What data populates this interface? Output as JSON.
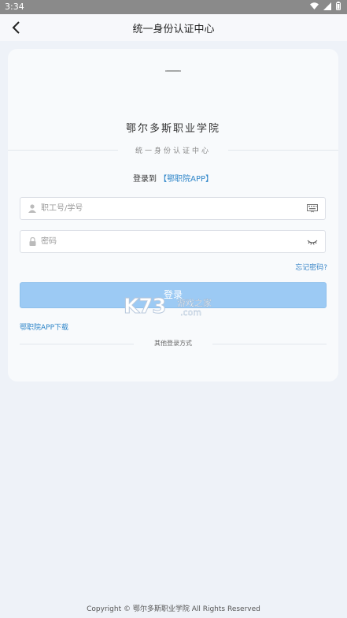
{
  "status_bar": {
    "time": "3:34"
  },
  "header": {
    "title": "统一身份认证中心"
  },
  "card": {
    "logo_text": "一",
    "school_name": "鄂尔多斯职业学院",
    "subtitle": "统一身份认证中心",
    "login_to_prefix": "登录到",
    "login_to_app": "【鄂职院APP】"
  },
  "form": {
    "username_placeholder": "职工号/学号",
    "password_placeholder": "密码",
    "forgot_label": "忘记密码?",
    "login_label": "登录"
  },
  "links": {
    "download_label": "鄂职院APP下载",
    "other_login_label": "其他登录方式"
  },
  "watermark": {
    "brand": "K73",
    "cn": "游戏之家",
    "domain": ".com"
  },
  "footer": {
    "copyright": "Copyright © 鄂尔多斯职业学院 All Rights Reserved"
  },
  "colors": {
    "accent": "#2f86c9",
    "button": "#9ccaf4",
    "background": "#eef2f8"
  }
}
